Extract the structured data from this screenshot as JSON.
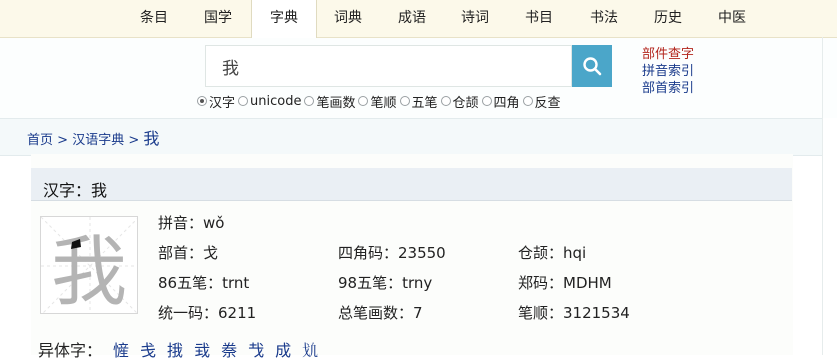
{
  "nav": {
    "tabs": [
      "条目",
      "国学",
      "字典",
      "词典",
      "成语",
      "诗词",
      "书目",
      "书法",
      "历史",
      "中医"
    ],
    "active_index": 2
  },
  "search": {
    "value": "我",
    "button_icon": "search-icon"
  },
  "side_links": [
    "部件查字",
    "拼音索引",
    "部首索引"
  ],
  "search_modes": {
    "options": [
      "汉字",
      "unicode",
      "笔画数",
      "笔顺",
      "五笔",
      "仓颉",
      "四角",
      "反查"
    ],
    "selected": "汉字"
  },
  "breadcrumb": {
    "home": "首页",
    "sep1": ">",
    "dictionary": "汉语字典",
    "sep2": ">",
    "current": "我"
  },
  "entry": {
    "title": "汉字：我",
    "character": "我",
    "pinyin": "拼音：wǒ",
    "radical": "部首：戈",
    "four_corner": "四角码：23550",
    "cangjie": "仓颉：hqi",
    "wubi86": "86五笔：trnt",
    "wubi98": "98五笔：trny",
    "zhengma": "郑码：MDHM",
    "unicode": "统一码：6211",
    "stroke_count": "总笔画数：7",
    "stroke_order": "笔顺：3121534"
  },
  "variants": {
    "label": "异体字：",
    "items": [
      "㦃",
      "戋",
      "㧴",
      "㦱",
      "䄅",
      "𢦏",
      "成",
      "𢦕"
    ]
  },
  "colors": {
    "nav_bg": "#fcf9ea",
    "search_button": "#4ba6c9",
    "link": "#1a3b8c",
    "link_red": "#b3261e",
    "section_bar": "#eaeff4"
  }
}
